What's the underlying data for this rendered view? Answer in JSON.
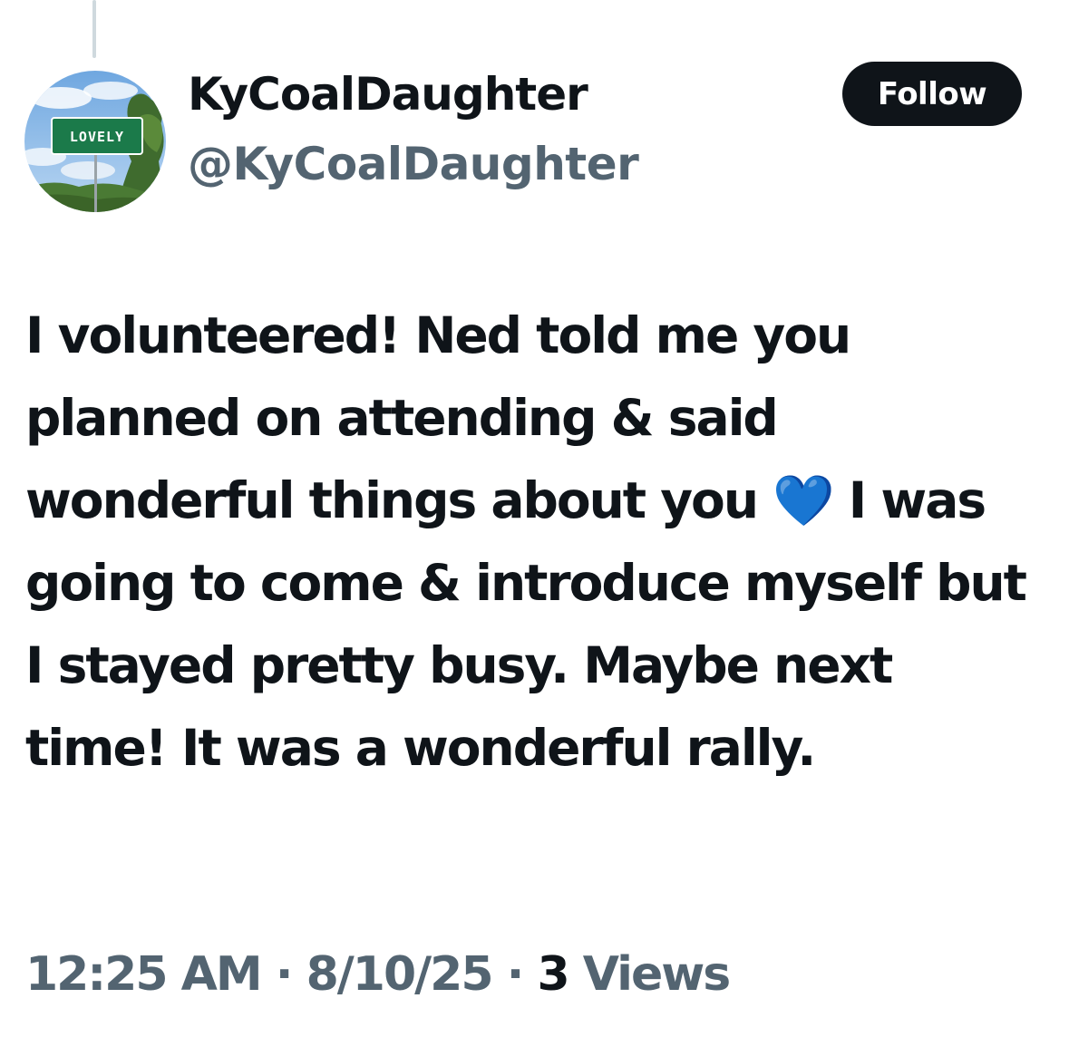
{
  "tweet": {
    "author": {
      "display_name": "KyCoalDaughter",
      "handle": "@KyCoalDaughter",
      "avatar_sign_text": "LOVELY",
      "avatar_icon": "profile-photo-road-sign"
    },
    "follow_label": "Follow",
    "text": "I volunteered! Ned told me you planned on attending & said wonderful things about you 💙 I was going to come & introduce myself but I stayed pretty busy. Maybe next time! It was a wonderful rally.",
    "time": "12:25 AM",
    "date": "8/10/25",
    "separator": "·",
    "views_count": "3",
    "views_label": "Views"
  },
  "colors": {
    "primary_text": "#0f1419",
    "secondary_text": "#536471",
    "follow_bg": "#0f1419",
    "follow_text": "#ffffff",
    "thread_line": "#cfd9de",
    "heart": "#1d6df2"
  }
}
